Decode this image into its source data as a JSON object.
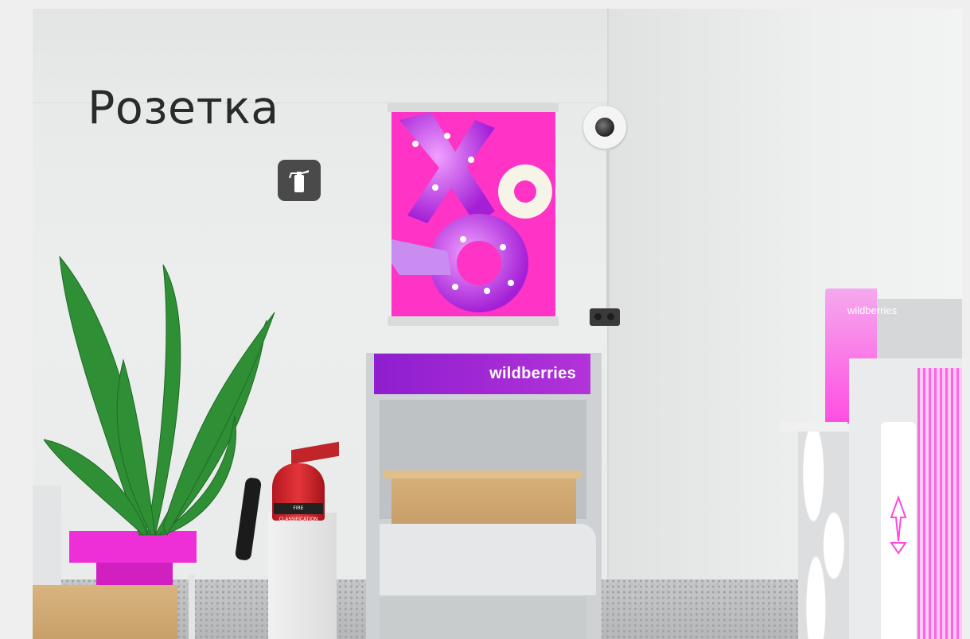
{
  "annotation": {
    "label": "Розетка"
  },
  "signage": {
    "stand_brand": "wildberries",
    "kiosk_brand": "wildberries",
    "extinguisher_tag": "FIRE CLASSIFICATION"
  },
  "colors": {
    "brand_purple": "#9b24d3",
    "brand_pink": "#ff2fc2",
    "label_text": "#2a2a2a",
    "sign_background": "#4a4a4a"
  },
  "icons": {
    "fire_extinguisher_sign": "fire-extinguisher-icon",
    "camera": "security-camera-icon",
    "outlet": "power-outlet-icon",
    "recycle": "recycle-icon"
  }
}
